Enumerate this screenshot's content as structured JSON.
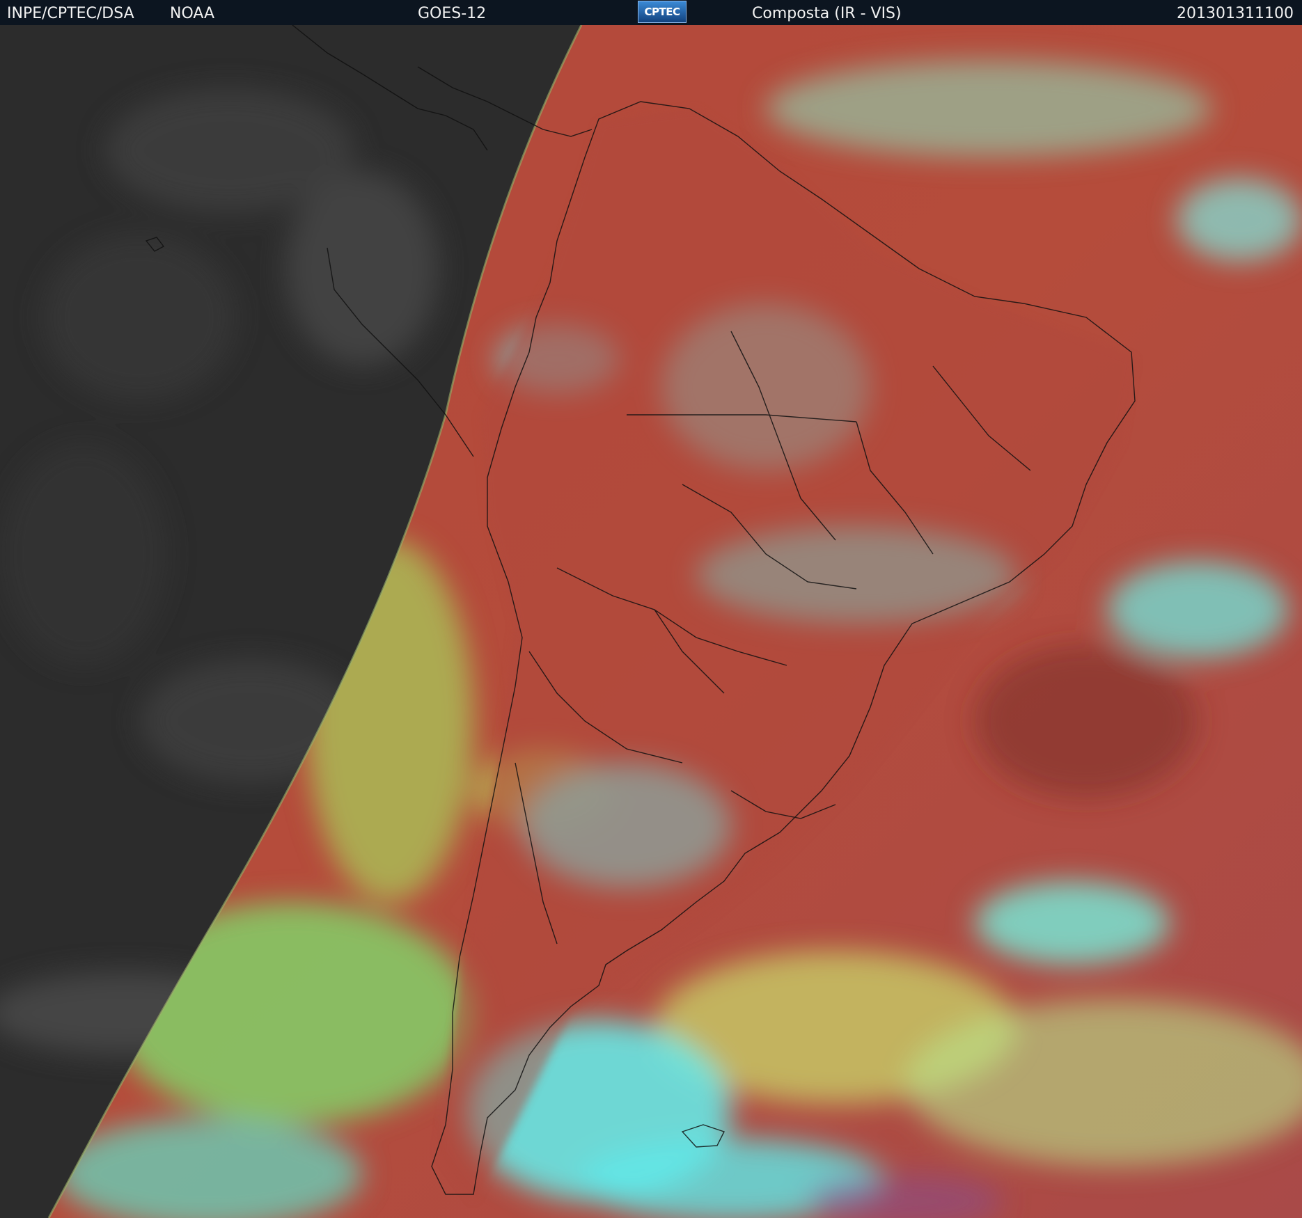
{
  "header": {
    "source": "INPE/CPTEC/DSA",
    "agency": "NOAA",
    "satellite": "GOES-12",
    "logo_text": "CPTEC",
    "product": "Composta (IR - VIS)",
    "timestamp": "201301311100"
  },
  "colors": {
    "header_bg": "#0c1520",
    "night_side": "#2b2b2b",
    "clear_ocean": "#b94a3a",
    "land_warm": "#b24a3c",
    "low_cloud": "#a7d85a",
    "high_cloud": "#5fe8e8",
    "coastline": "#111111"
  },
  "icons": [
    "cptec-logo-icon"
  ]
}
